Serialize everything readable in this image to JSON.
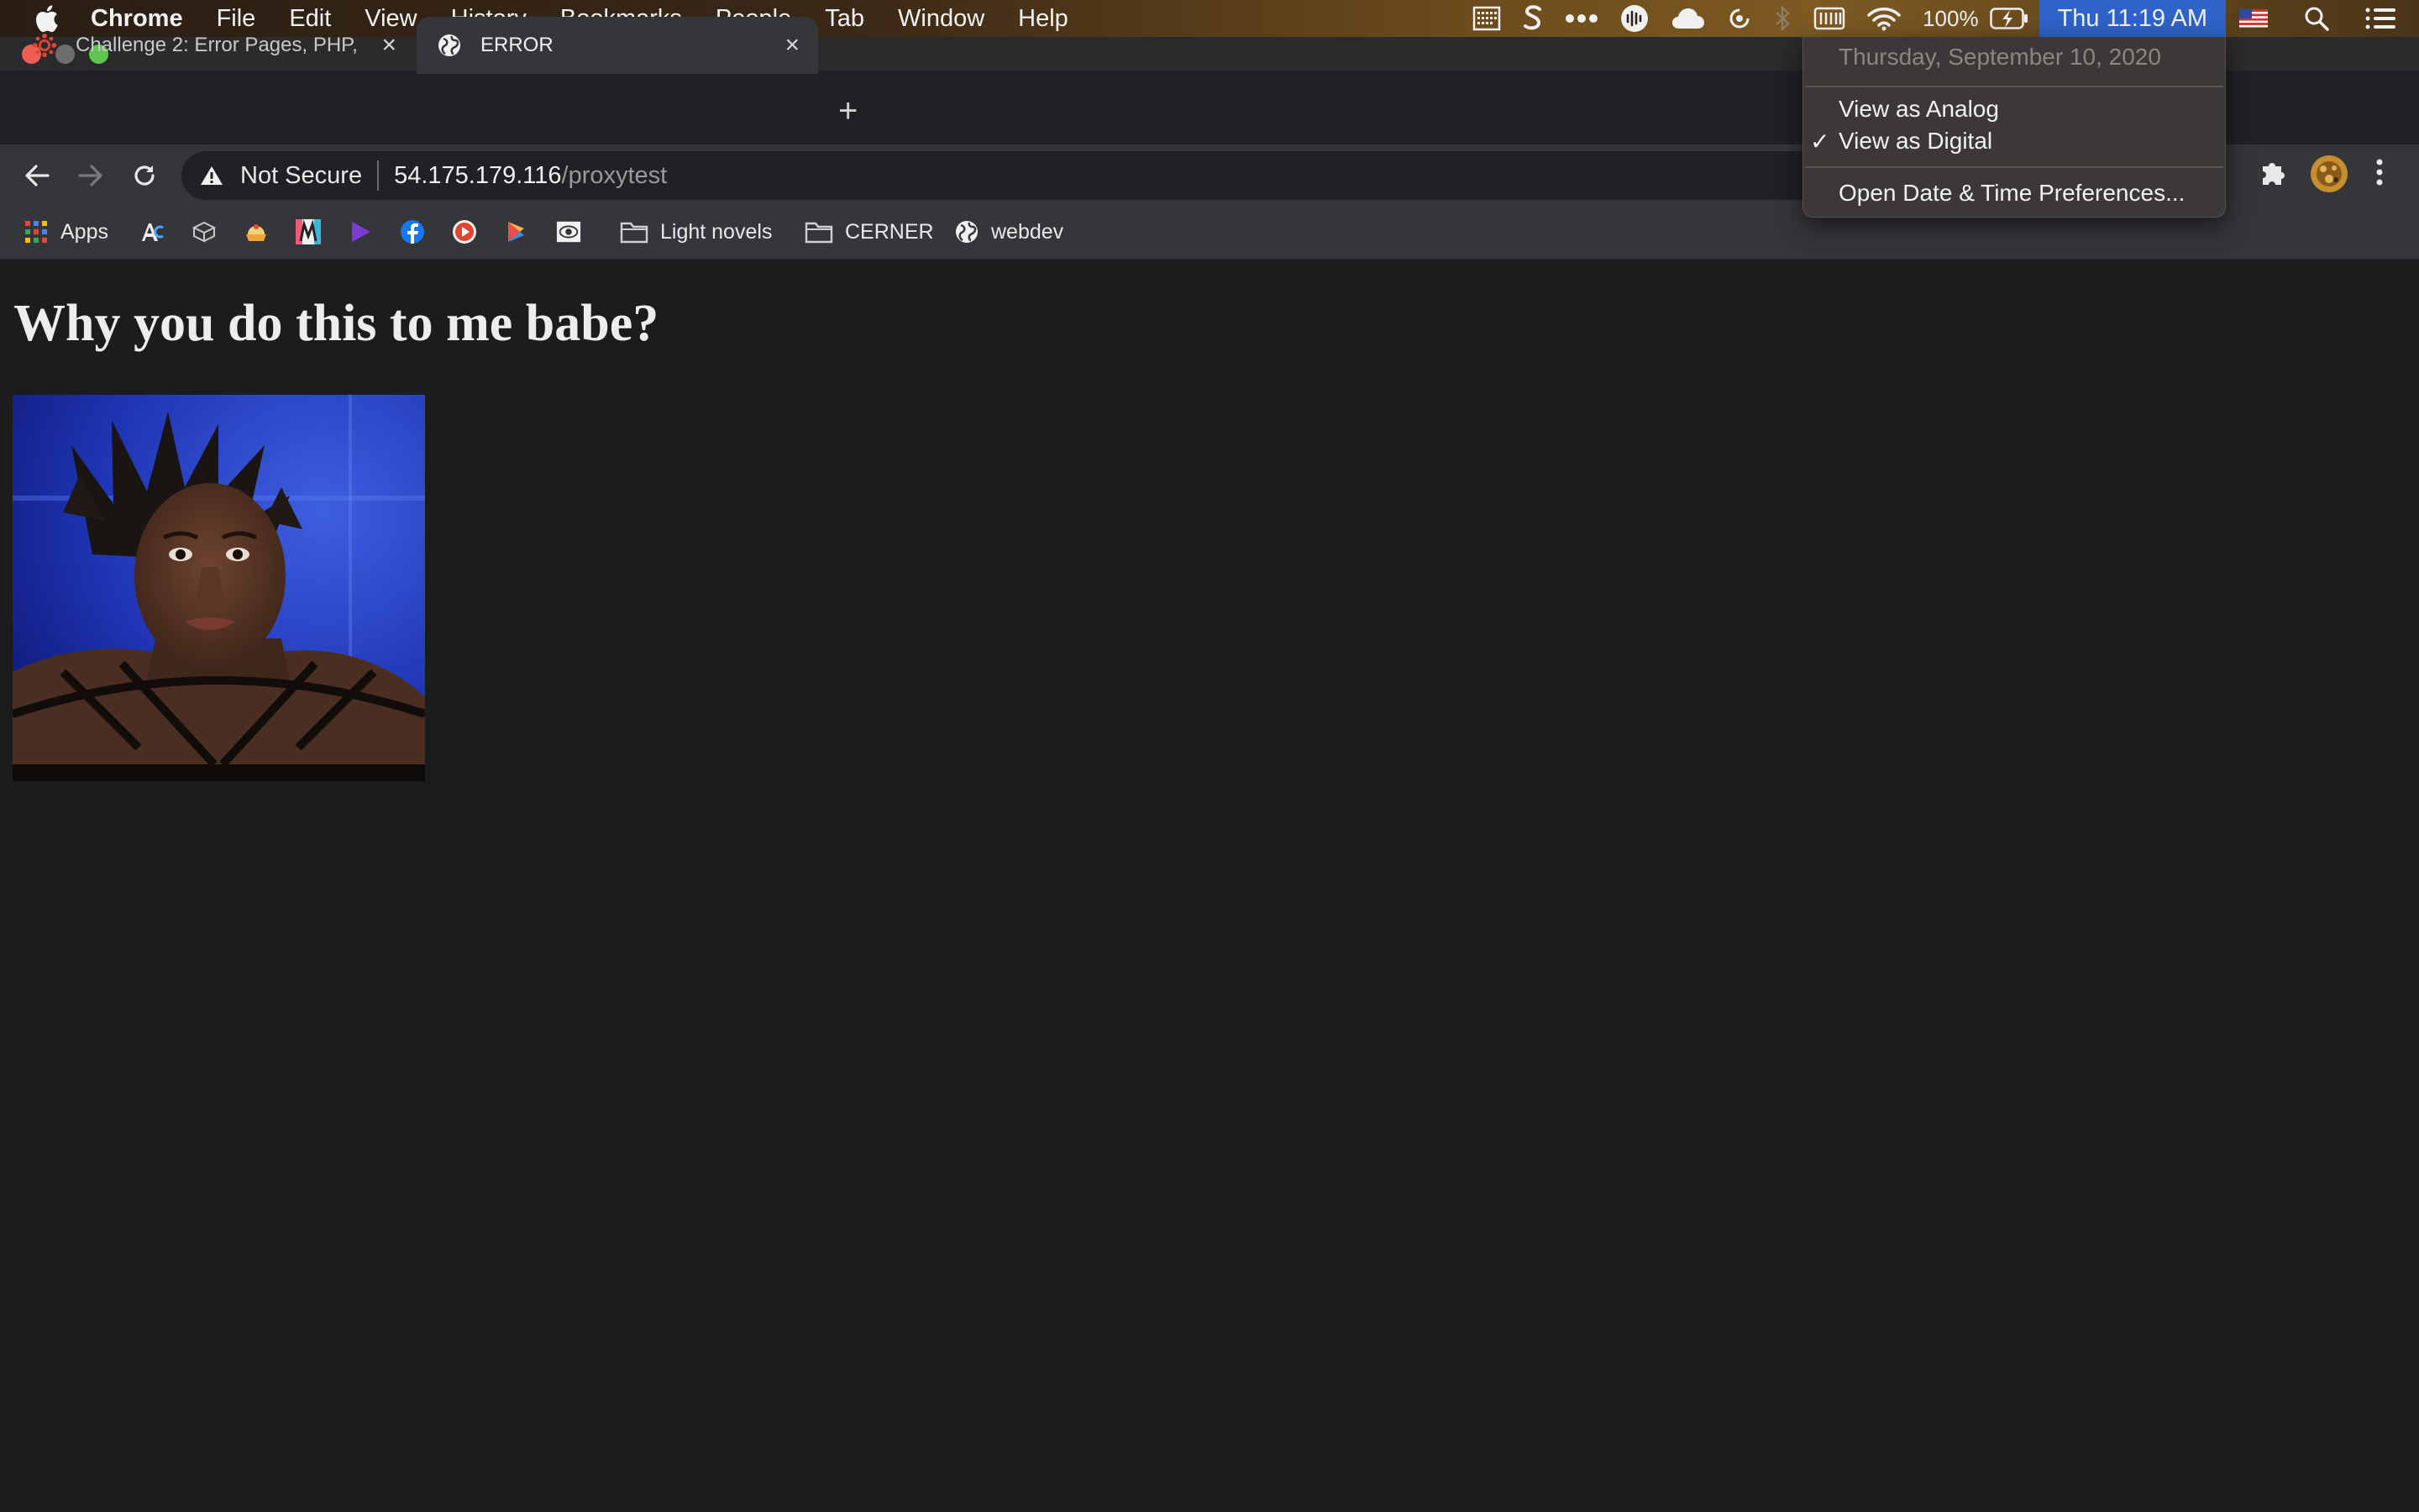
{
  "menubar": {
    "app_name": "Chrome",
    "items": [
      "File",
      "Edit",
      "View",
      "History",
      "Bookmarks",
      "People",
      "Tab",
      "Window",
      "Help"
    ],
    "battery": "100%",
    "clock": "Thu 11:19 AM"
  },
  "tabs": [
    {
      "title": "Challenge 2: Error Pages, PHP, ",
      "close": "×",
      "active": false
    },
    {
      "title": "ERROR",
      "close": "×",
      "active": true
    }
  ],
  "new_tab_label": "+",
  "address_bar": {
    "security": "Not Secure",
    "host": "54.175.179.116",
    "path": "/proxytest"
  },
  "bookmarks": {
    "apps_label": "Apps",
    "folders": [
      "Light novels",
      "CERNER"
    ],
    "webdev_label": "webdev"
  },
  "page": {
    "heading": "Why you do this to me babe?"
  },
  "clock_menu": {
    "date": "Thursday, September 10, 2020",
    "view_analog": "View as Analog",
    "view_digital": "View as Digital",
    "check_mark": "✓",
    "preferences": "Open Date & Time Preferences..."
  },
  "colors": {
    "menubar_highlight": "#2f63c7",
    "page_background": "#1b1c1e",
    "tab_active": "#35363a"
  },
  "icons": [
    "apple-icon",
    "calendar-icon",
    "scrivener-icon",
    "dots-icon",
    "audio-icon",
    "cloud-icon",
    "spinner-icon",
    "bluetooth-icon",
    "keyboard-icon",
    "wifi-icon",
    "battery-icon",
    "flag-icon",
    "spotlight-icon",
    "notification-list-icon",
    "globe-icon",
    "back-icon",
    "forward-icon",
    "reload-icon",
    "warning-icon",
    "puzzle-icon",
    "profile-avatar",
    "menu-dots-icon",
    "folder-icon"
  ]
}
